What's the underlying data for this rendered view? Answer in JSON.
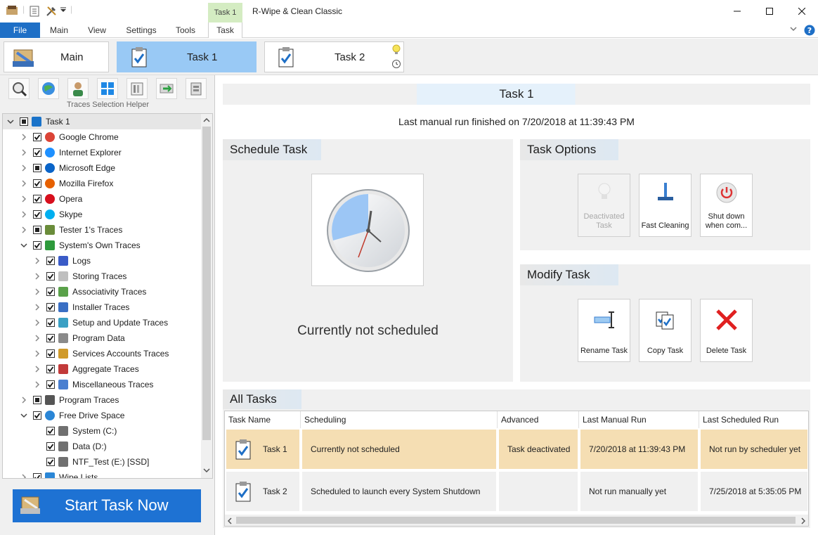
{
  "app": {
    "title": "R-Wipe & Clean Classic",
    "context_tab": "Task 1"
  },
  "ribbon": {
    "tabs": [
      "File",
      "Main",
      "View",
      "Settings",
      "Tools",
      "Task"
    ]
  },
  "big_tabs": {
    "main": "Main",
    "task1": "Task 1",
    "task2": "Task 2"
  },
  "left": {
    "helper_label": "Traces Selection Helper",
    "start_button": "Start Task Now",
    "tree": [
      {
        "label": "Task 1",
        "level": 0,
        "expanded": true,
        "check": "partial",
        "icon": "task-icon",
        "color": "#1a73c9"
      },
      {
        "label": "Google Chrome",
        "level": 1,
        "check": "checked",
        "icon": "chrome-icon",
        "color": "#db4437"
      },
      {
        "label": "Internet  Explorer",
        "level": 1,
        "check": "checked",
        "icon": "ie-icon",
        "color": "#1e90ff"
      },
      {
        "label": "Microsoft Edge",
        "level": 1,
        "check": "partial",
        "icon": "edge-icon",
        "color": "#0a64c8"
      },
      {
        "label": "Mozilla  Firefox",
        "level": 1,
        "check": "checked",
        "icon": "firefox-icon",
        "color": "#e66000"
      },
      {
        "label": "Opera",
        "level": 1,
        "check": "checked",
        "icon": "opera-icon",
        "color": "#d70f1d"
      },
      {
        "label": "Skype",
        "level": 1,
        "check": "checked",
        "icon": "skype-icon",
        "color": "#00aff0"
      },
      {
        "label": "Tester 1's Traces",
        "level": 1,
        "check": "partial",
        "icon": "user-icon",
        "color": "#6a8c3a"
      },
      {
        "label": "System's Own Traces",
        "level": 1,
        "expanded": true,
        "check": "checked",
        "icon": "system-icon",
        "color": "#2e9a3c"
      },
      {
        "label": "Logs",
        "level": 2,
        "check": "checked",
        "icon": "logs-icon",
        "color": "#3a5bc7"
      },
      {
        "label": "Storing Traces",
        "level": 2,
        "check": "checked",
        "icon": "storing-icon",
        "color": "#bfbfbf"
      },
      {
        "label": "Associativity Traces",
        "level": 2,
        "check": "checked",
        "icon": "associativity-icon",
        "color": "#5aa14a"
      },
      {
        "label": "Installer Traces",
        "level": 2,
        "check": "checked",
        "icon": "installer-icon",
        "color": "#3a6fc4"
      },
      {
        "label": "Setup and Update Traces",
        "level": 2,
        "check": "checked",
        "icon": "setup-icon",
        "color": "#3aa0c4"
      },
      {
        "label": "Program Data",
        "level": 2,
        "check": "checked",
        "icon": "program-data-icon",
        "color": "#8a8a8a"
      },
      {
        "label": "Services Accounts Traces",
        "level": 2,
        "check": "checked",
        "icon": "services-icon",
        "color": "#d09a2a"
      },
      {
        "label": "Aggregate Traces",
        "level": 2,
        "check": "checked",
        "icon": "aggregate-icon",
        "color": "#c23a3a"
      },
      {
        "label": "Miscellaneous Traces",
        "level": 2,
        "check": "checked",
        "icon": "misc-icon",
        "color": "#4a7fd0"
      },
      {
        "label": "Program Traces",
        "level": 1,
        "check": "partial",
        "icon": "program-traces-icon",
        "color": "#555555"
      },
      {
        "label": "Free Drive Space",
        "level": 1,
        "expanded": true,
        "check": "checked",
        "icon": "globe-icon",
        "color": "#2a86d6"
      },
      {
        "label": "System  (C:)",
        "level": 2,
        "noexp": true,
        "check": "checked",
        "icon": "drive-icon",
        "color": "#707070"
      },
      {
        "label": "Data  (D:)",
        "level": 2,
        "noexp": true,
        "check": "checked",
        "icon": "drive-icon",
        "color": "#707070"
      },
      {
        "label": "NTF_Test  (E:) [SSD]",
        "level": 2,
        "noexp": true,
        "check": "checked",
        "icon": "drive-icon",
        "color": "#707070"
      },
      {
        "label": "Wipe Lists",
        "level": 1,
        "check": "checked",
        "icon": "wipe-list-icon",
        "color": "#2a86d6"
      }
    ]
  },
  "task_header": {
    "title": "Task 1",
    "last_run": "Last manual run finished on 7/20/2018 at 11:39:43 PM"
  },
  "schedule": {
    "title": "Schedule Task",
    "status": "Currently not scheduled"
  },
  "options": {
    "title": "Task Options",
    "buttons": [
      "Deactivated Task",
      "Fast Cleaning",
      "Shut down when com..."
    ]
  },
  "modify": {
    "title": "Modify Task",
    "buttons": [
      "Rename Task",
      "Copy Task",
      "Delete Task"
    ]
  },
  "all_tasks": {
    "title": "All Tasks",
    "columns": [
      "Task Name",
      "Scheduling",
      "Advanced",
      "Last Manual Run",
      "Last Scheduled Run"
    ],
    "rows": [
      [
        "Task 1",
        "Currently not scheduled",
        "Task deactivated",
        "7/20/2018 at 11:39:43 PM",
        "Not run by scheduler yet"
      ],
      [
        "Task 2",
        "Scheduled to launch every System Shutdown",
        "",
        "Not run manually yet",
        "7/25/2018 at 5:35:05 PM"
      ]
    ]
  },
  "colors": {
    "accent": "#1e72d3",
    "selected_tab": "#99c9f5",
    "selected_row": "#f5deb3",
    "context_band": "#d4ecc2",
    "panel_bg": "#f0f0f0"
  }
}
